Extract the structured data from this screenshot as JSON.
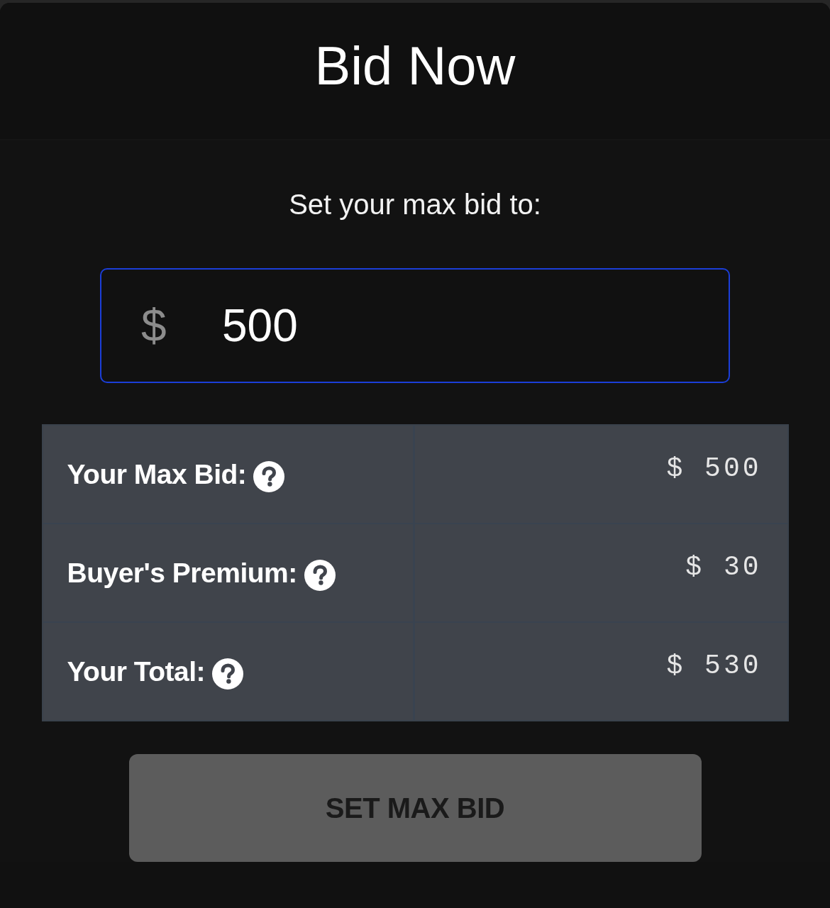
{
  "header": {
    "title": "Bid Now"
  },
  "bid_form": {
    "prompt": "Set your max bid to:",
    "amount_field": {
      "prefix": "$",
      "value": "500",
      "focused": true
    }
  },
  "summary": [
    {
      "label": "Your Max Bid:",
      "amount": "$ 500"
    },
    {
      "label": "Buyer's Premium:",
      "amount": "$ 30"
    },
    {
      "label": "Your Total:",
      "amount": "$ 530"
    }
  ],
  "submit_button": {
    "label": "SET MAX BID",
    "disabled": true
  }
}
